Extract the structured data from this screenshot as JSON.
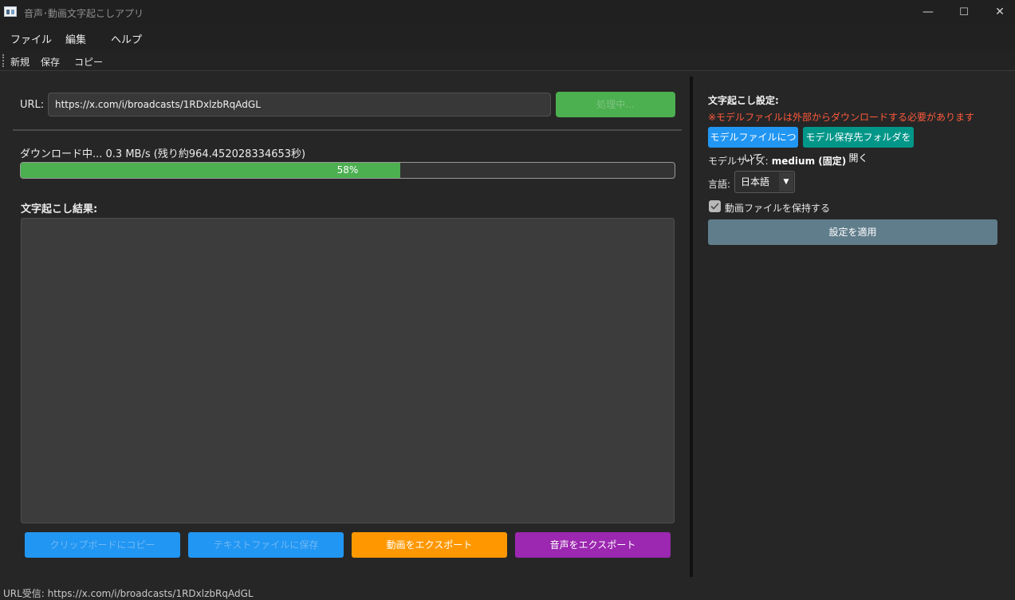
{
  "window": {
    "title": "音声･動画文字起こしアプリ",
    "controls": {
      "minimize": "—",
      "maximize": "☐",
      "close": "✕"
    }
  },
  "menubar": {
    "items": [
      "ファイル",
      "編集",
      "ヘルプ"
    ]
  },
  "toolbar": {
    "items": [
      "新規",
      "保存",
      "コピー"
    ]
  },
  "url": {
    "label": "URL:",
    "value": "https://x.com/i/broadcasts/1RDxlzbRqAdGL",
    "start_button": "処理中..."
  },
  "download": {
    "status": "ダウンロード中... 0.3 MB/s (残り約964.452028334653秒)",
    "progress_percent": 58,
    "progress_text": "58%"
  },
  "result": {
    "label": "文字起こし結果:",
    "text": ""
  },
  "bottom_buttons": {
    "copy": "クリップボードにコピー",
    "save_text": "テキストファイルに保存",
    "export_video": "動画をエクスポート",
    "export_audio": "音声をエクスポート"
  },
  "settings": {
    "label": "文字起こし設定:",
    "warning": "※モデルファイルは外部からダウンロードする必要があります",
    "about_model_button": "モデルファイルについて",
    "open_folder_button": "モデル保存先フォルダを開く",
    "model_size_label": "モデルサイズ:",
    "model_size_value": "medium (固定)",
    "language_label": "言語:",
    "language_value": "日本語",
    "keep_video_label": "動画ファイルを保持する",
    "keep_video_checked": true,
    "apply_button": "設定を適用"
  },
  "statusbar": {
    "text": "URL受信: https://x.com/i/broadcasts/1RDxlzbRqAdGL"
  },
  "colors": {
    "green": "#4caf50",
    "blue": "#2196f3",
    "orange": "#ff9800",
    "purple": "#9c27b0",
    "teal": "#009688",
    "warning": "#ff5a3c",
    "apply": "#607d8b"
  },
  "icons": {
    "app": "app-window-icon",
    "dropdown": "chevron-down-icon",
    "check": "checkmark-icon"
  }
}
